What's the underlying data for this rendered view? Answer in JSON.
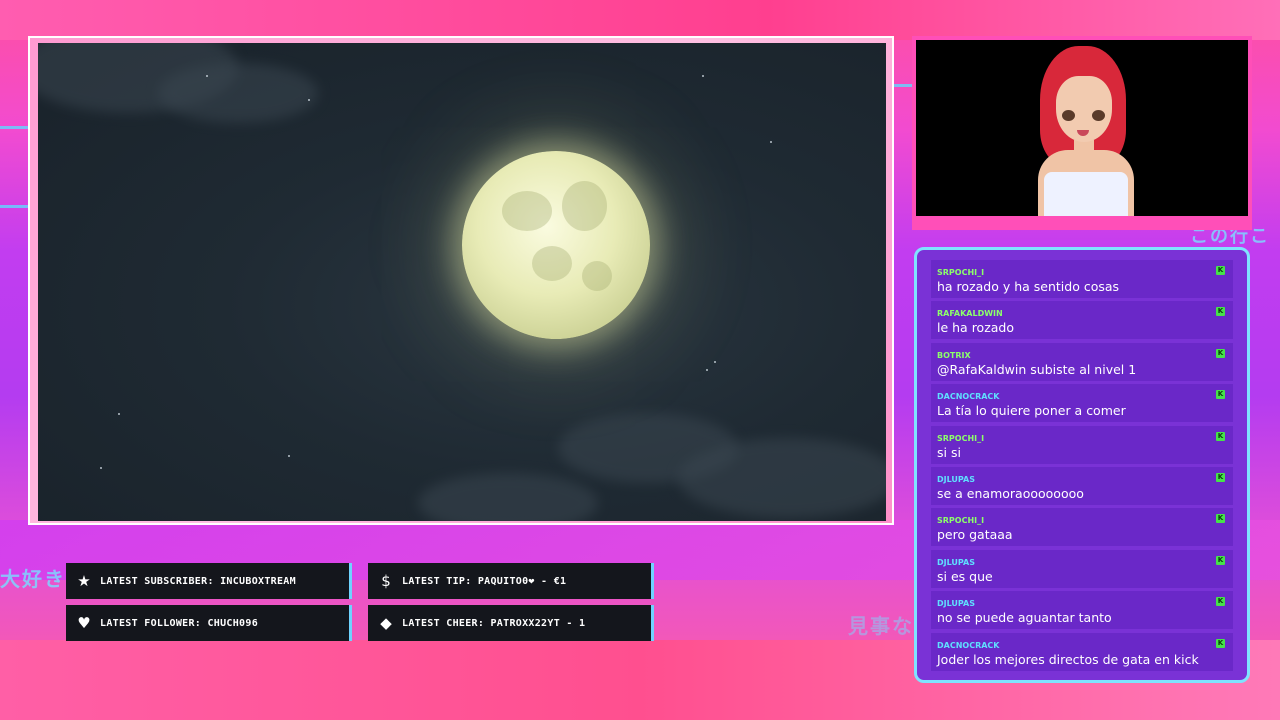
{
  "overlay": {
    "jp_top_right": "この行こ",
    "jp_left": "大好き",
    "jp_bottom_right": "見事な"
  },
  "stats": {
    "latest_subscriber": "LATEST SUBSCRIBER: INCUBOXTREAM",
    "latest_tip": "LATEST TIP: PAQUITO0❤ - €1",
    "latest_follower": "LATEST FOLLOWER: CHUCH096",
    "latest_cheer": "LATEST CHEER: PATROXX22YT - 1"
  },
  "icons": {
    "subscriber": "star-icon",
    "tip": "dollar-icon",
    "follower": "heart-icon",
    "cheer": "diamond-icon"
  },
  "chat": {
    "messages": [
      {
        "user": "SRPOCHI_I",
        "text": "ha rozado y ha sentido cosas",
        "color": "#8dff6a"
      },
      {
        "user": "RAFAKALDWIN",
        "text": "le ha rozado",
        "color": "#8dff6a"
      },
      {
        "user": "BOTRIX",
        "text": "@RafaKaldwin subiste al nivel 1",
        "color": "#8dff6a"
      },
      {
        "user": "DACNOCRACK",
        "text": "La tía lo quiere poner a comer",
        "color": "#5fe0ff"
      },
      {
        "user": "SRPOCHI_I",
        "text": "si si",
        "color": "#8dff6a"
      },
      {
        "user": "DJLUPAS",
        "text": "se a enamoraoooooooo",
        "color": "#5fe0ff"
      },
      {
        "user": "SRPOCHI_I",
        "text": "pero gataaa",
        "color": "#8dff6a"
      },
      {
        "user": "DJLUPAS",
        "text": "si es que",
        "color": "#5fe0ff"
      },
      {
        "user": "DJLUPAS",
        "text": "no se puede aguantar tanto",
        "color": "#5fe0ff"
      },
      {
        "user": "DACNOCRACK",
        "text": "Joder los mejores directos de gata en kick",
        "color": "#5fe0ff"
      }
    ],
    "badge": "K"
  },
  "colors": {
    "chat_border": "#7fe3ff",
    "chat_bg": "#7a32d6",
    "stat_bg": "#14161c",
    "accent_pink": "#ff4fb8"
  }
}
